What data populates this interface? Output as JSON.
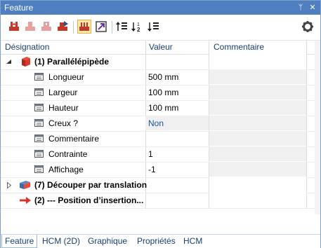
{
  "window": {
    "title": "Feature",
    "pin_glyph": "ᛘ",
    "close_glyph": "✕"
  },
  "toolbar": {
    "icons": [
      "export-red-icon",
      "export-disabled-icon",
      "export-disabled-2-icon",
      "export-arrow-icon",
      "feature-view-icon",
      "arrow-purple-icon",
      "sort-up-icon",
      "sort-num-icon",
      "sort-down-icon",
      "gear-icon"
    ]
  },
  "grid": {
    "headers": {
      "designation": "Désignation",
      "valeur": "Valeur",
      "commentaire": "Commentaire"
    },
    "rows": [
      {
        "name": "(1) Parallélépipède",
        "value": "",
        "comment": ""
      },
      {
        "name": "Longueur",
        "value": "500 mm",
        "comment": ""
      },
      {
        "name": "Largeur",
        "value": "100 mm",
        "comment": ""
      },
      {
        "name": "Hauteur",
        "value": "100 mm",
        "comment": ""
      },
      {
        "name": "Creux ?",
        "value": "Non",
        "comment": ""
      },
      {
        "name": "Commentaire",
        "value": "",
        "comment": ""
      },
      {
        "name": "Contrainte",
        "value": "1",
        "comment": ""
      },
      {
        "name": "Affichage",
        "value": "-1",
        "comment": ""
      },
      {
        "name": "(7) Découper par translation",
        "value": "",
        "comment": ""
      },
      {
        "name": "(2) --- Position  d’insertion...",
        "value": "",
        "comment": ""
      }
    ]
  },
  "tabs": [
    "Feature",
    "HCM (2D)",
    "Graphique",
    "Propriétés",
    "HCM"
  ],
  "colors": {
    "titlebar": "#4f7ec1",
    "header_text": "#1a3e72",
    "value_blue": "#1a4e9a",
    "arrow_red": "#e0302a"
  }
}
